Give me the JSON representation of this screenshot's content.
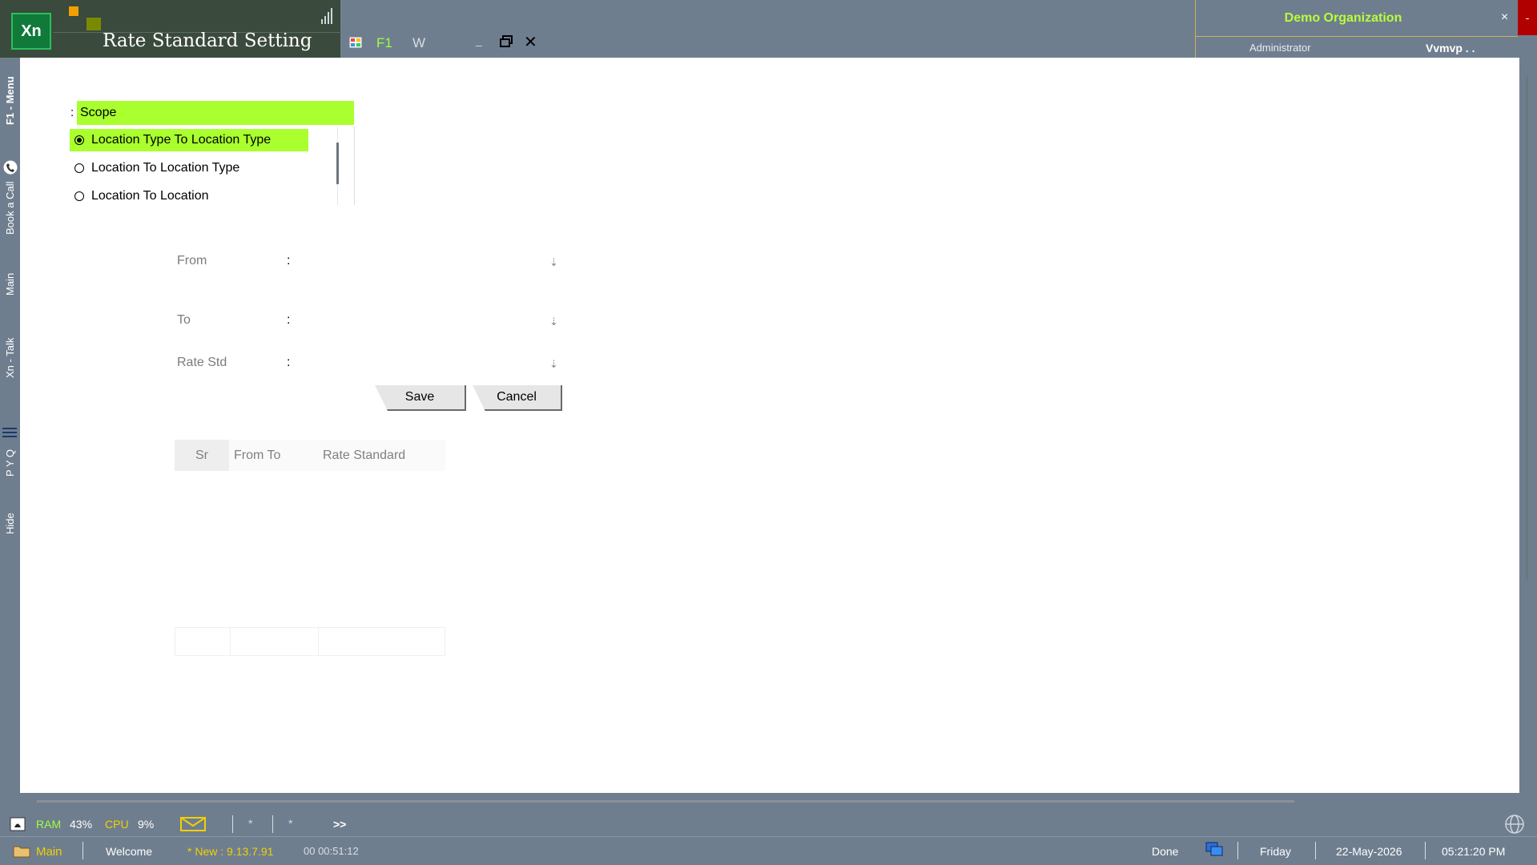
{
  "titlebar": {
    "logo": "Xn",
    "app_title": "Rate Standard Setting",
    "toolbar_f1": "F1",
    "toolbar_w": "W",
    "minimize": "_",
    "close": "✕"
  },
  "header": {
    "organization": "Demo Organization",
    "role": "Administrator",
    "user": "Vvmvp . .",
    "close": "×",
    "minimize": "-"
  },
  "siderail": {
    "menu": "F1 - Menu",
    "book_call": "Book a Call",
    "main": "Main",
    "talk": "Xn - Talk",
    "pyq": "P Y Q",
    "hide": "Hide"
  },
  "scope": {
    "colon": ":",
    "label": "Scope",
    "options": [
      {
        "label": "Location Type To Location Type",
        "selected": true
      },
      {
        "label": "Location To Location Type",
        "selected": false
      },
      {
        "label": "Location To Location",
        "selected": false
      }
    ]
  },
  "form": {
    "from_label": "From",
    "to_label": "To",
    "rate_std_label": "Rate Std",
    "colon": ":",
    "dropdown_glyph": "⇣",
    "save_label": "Save",
    "cancel_label": "Cancel"
  },
  "grid": {
    "columns": [
      "Sr",
      "From To",
      "Rate Standard"
    ]
  },
  "status1": {
    "ram_label": "RAM",
    "ram_value": "43%",
    "cpu_label": "CPU",
    "cpu_value": "9%",
    "star1": "*",
    "star2": "*",
    "more": ">>"
  },
  "status2": {
    "main": "Main",
    "welcome": "Welcome",
    "version": "* New : 9.13.7.91",
    "timer": "00 00:51:12",
    "done": "Done",
    "day": "Friday",
    "date": "22-May-2026",
    "time": "05:21:20 PM"
  },
  "colors": {
    "accent_green": "#aaff2e",
    "header_bg": "#6f7e8f",
    "title_block": "#3a4a3c",
    "org_text": "#b7ff3a",
    "close_red": "#b10000"
  }
}
